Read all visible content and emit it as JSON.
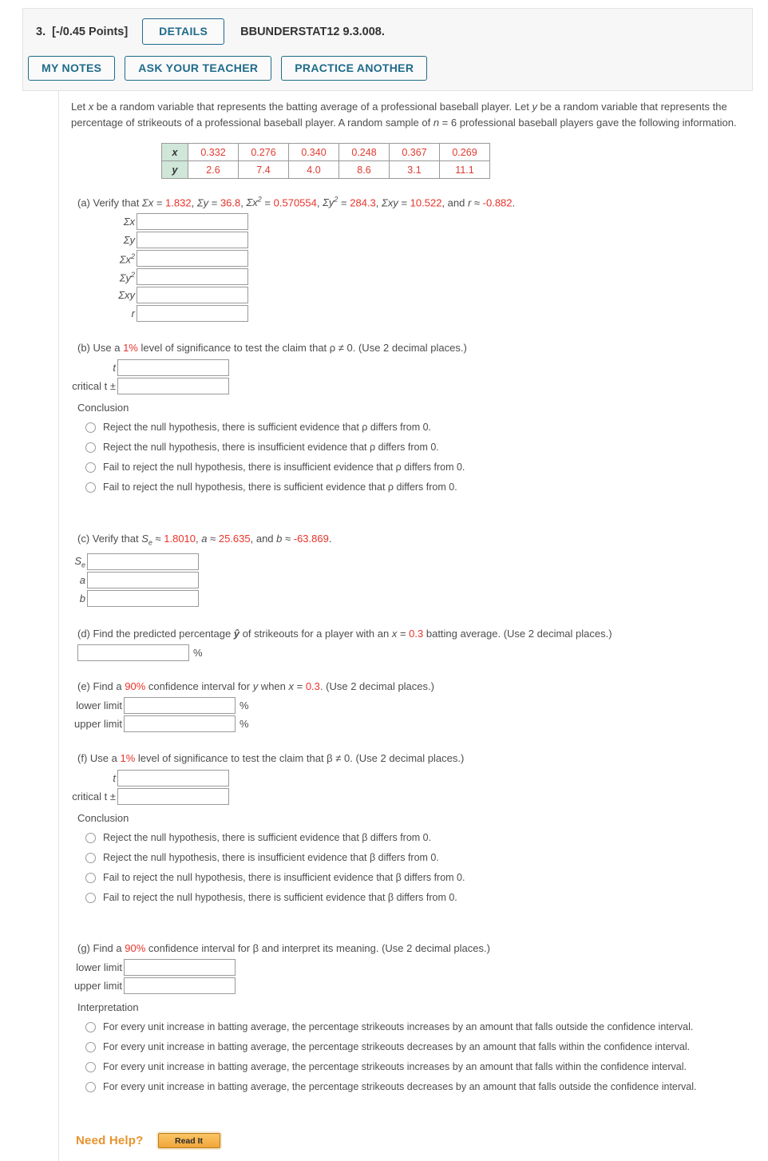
{
  "header": {
    "question_number": "3.",
    "points": "[-/0.45 Points]",
    "details_label": "DETAILS",
    "problem_code": "BBUNDERSTAT12 9.3.008.",
    "my_notes_label": "MY NOTES",
    "ask_teacher_label": "ASK YOUR TEACHER",
    "practice_another_label": "PRACTICE ANOTHER"
  },
  "problem": {
    "line1_a": "Let ",
    "line1_x": "x",
    "line1_b": " be a random variable that represents the batting average of a professional baseball player. Let ",
    "line1_y": "y",
    "line1_c": " be a random variable that represents the percentage of strikeouts of a professional baseball player. A random sample of ",
    "line1_n": "n",
    "line1_d": " = 6 professional baseball players gave the following information."
  },
  "data_table": {
    "x_label": "x",
    "y_label": "y",
    "x_values": [
      "0.332",
      "0.276",
      "0.340",
      "0.248",
      "0.367",
      "0.269"
    ],
    "y_values": [
      "2.6",
      "7.4",
      "4.0",
      "8.6",
      "3.1",
      "11.1"
    ],
    "header_bg": "#cfe6d8",
    "value_color": "#e03b2f"
  },
  "part_a": {
    "prefix": "(a) Verify that ",
    "sum_x_label": "Σx",
    "sum_x_value": "1.832",
    "sum_y_label": "Σy",
    "sum_y_value": "36.8",
    "sum_x2_value": "0.570554",
    "sum_y2_value": "284.3",
    "sum_xy_label": "Σxy",
    "sum_xy_value": "10.522",
    "r_label": "r",
    "r_value": "-0.882",
    "fields": [
      {
        "label": "Σx",
        "sup": "",
        "value": "",
        "name": "sum-x"
      },
      {
        "label": "Σy",
        "sup": "",
        "value": "",
        "name": "sum-y"
      },
      {
        "label": "Σx",
        "sup": "2",
        "value": "",
        "name": "sum-x-squared"
      },
      {
        "label": "Σy",
        "sup": "2",
        "value": "",
        "name": "sum-y-squared"
      },
      {
        "label": "Σxy",
        "sup": "",
        "value": "",
        "name": "sum-xy"
      },
      {
        "label": "r",
        "sup": "",
        "value": "",
        "name": "r"
      }
    ]
  },
  "part_b": {
    "text_1": "(b) Use a ",
    "level": "1%",
    "text_2": " level of significance to test the claim that ρ ≠ 0. (Use 2 decimal places.)",
    "t_label": "t",
    "t_value": "",
    "critical_label": "critical t ±",
    "critical_value": "",
    "conclusion_label": "Conclusion",
    "options": [
      "Reject the null hypothesis, there is sufficient evidence that ρ differs from 0.",
      "Reject the null hypothesis, there is insufficient evidence that ρ differs from 0.",
      "Fail to reject the null hypothesis, there is insufficient evidence that ρ differs from 0.",
      "Fail to reject the null hypothesis, there is sufficient evidence that ρ differs from 0."
    ]
  },
  "part_c": {
    "prefix": "(c) Verify that ",
    "se_symbol": "S",
    "se_sub": "e",
    "se_value": "1.8010",
    "a_value": "25.635",
    "b_value": "-63.869",
    "fields": [
      {
        "label": "S",
        "sub": "e",
        "value": "",
        "name": "se"
      },
      {
        "label": "a",
        "sub": "",
        "value": "",
        "name": "a"
      },
      {
        "label": "b",
        "sub": "",
        "value": "",
        "name": "b"
      }
    ]
  },
  "part_d": {
    "text_1": "(d) Find the predicted percentage ",
    "yhat": "ŷ",
    "text_2": " of strikeouts for a player with an ",
    "x_sym": "x",
    "x_eq": " = ",
    "x_value": "0.3",
    "text_3": " batting average. (Use 2 decimal places.)",
    "value": "",
    "unit": "%"
  },
  "part_e": {
    "text_1": "(e) Find a ",
    "level": "90%",
    "text_2": " confidence interval for ",
    "y_sym": "y",
    "text_3": " when ",
    "x_sym": "x",
    "x_eq": " = ",
    "x_value": "0.3",
    "text_4": ". (Use 2 decimal places.)",
    "lower_label": "lower limit",
    "lower_value": "",
    "upper_label": "upper limit",
    "upper_value": "",
    "unit": "%"
  },
  "part_f": {
    "text_1": "(f) Use a ",
    "level": "1%",
    "text_2": " level of significance to test the claim that β ≠ 0. (Use 2 decimal places.)",
    "t_label": "t",
    "t_value": "",
    "critical_label": "critical t ±",
    "critical_value": "",
    "conclusion_label": "Conclusion",
    "options": [
      "Reject the null hypothesis, there is sufficient evidence that β differs from 0.",
      "Reject the null hypothesis, there is insufficient evidence that β differs from 0.",
      "Fail to reject the null hypothesis, there is insufficient evidence that β differs from 0.",
      "Fail to reject the null hypothesis, there is sufficient evidence that β differs from 0."
    ]
  },
  "part_g": {
    "text_1": "(g) Find a ",
    "level": "90%",
    "text_2": " confidence interval for β and interpret its meaning. (Use 2 decimal places.)",
    "lower_label": "lower limit",
    "lower_value": "",
    "upper_label": "upper limit",
    "upper_value": "",
    "interpretation_label": "Interpretation",
    "options": [
      "For every unit increase in batting average, the percentage strikeouts increases by an amount that falls outside the confidence interval.",
      "For every unit increase in batting average, the percentage strikeouts decreases by an amount that falls within the confidence interval.",
      "For every unit increase in batting average, the percentage strikeouts increases by an amount that falls within the confidence interval.",
      "For every unit increase in batting average, the percentage strikeouts decreases by an amount that falls outside the confidence interval."
    ]
  },
  "footer": {
    "need_help_label": "Need Help?",
    "read_it_label": "Read It"
  },
  "colors": {
    "accent_teal": "#1f6b8a",
    "value_red": "#e8342a",
    "orange": "#e8932c"
  }
}
